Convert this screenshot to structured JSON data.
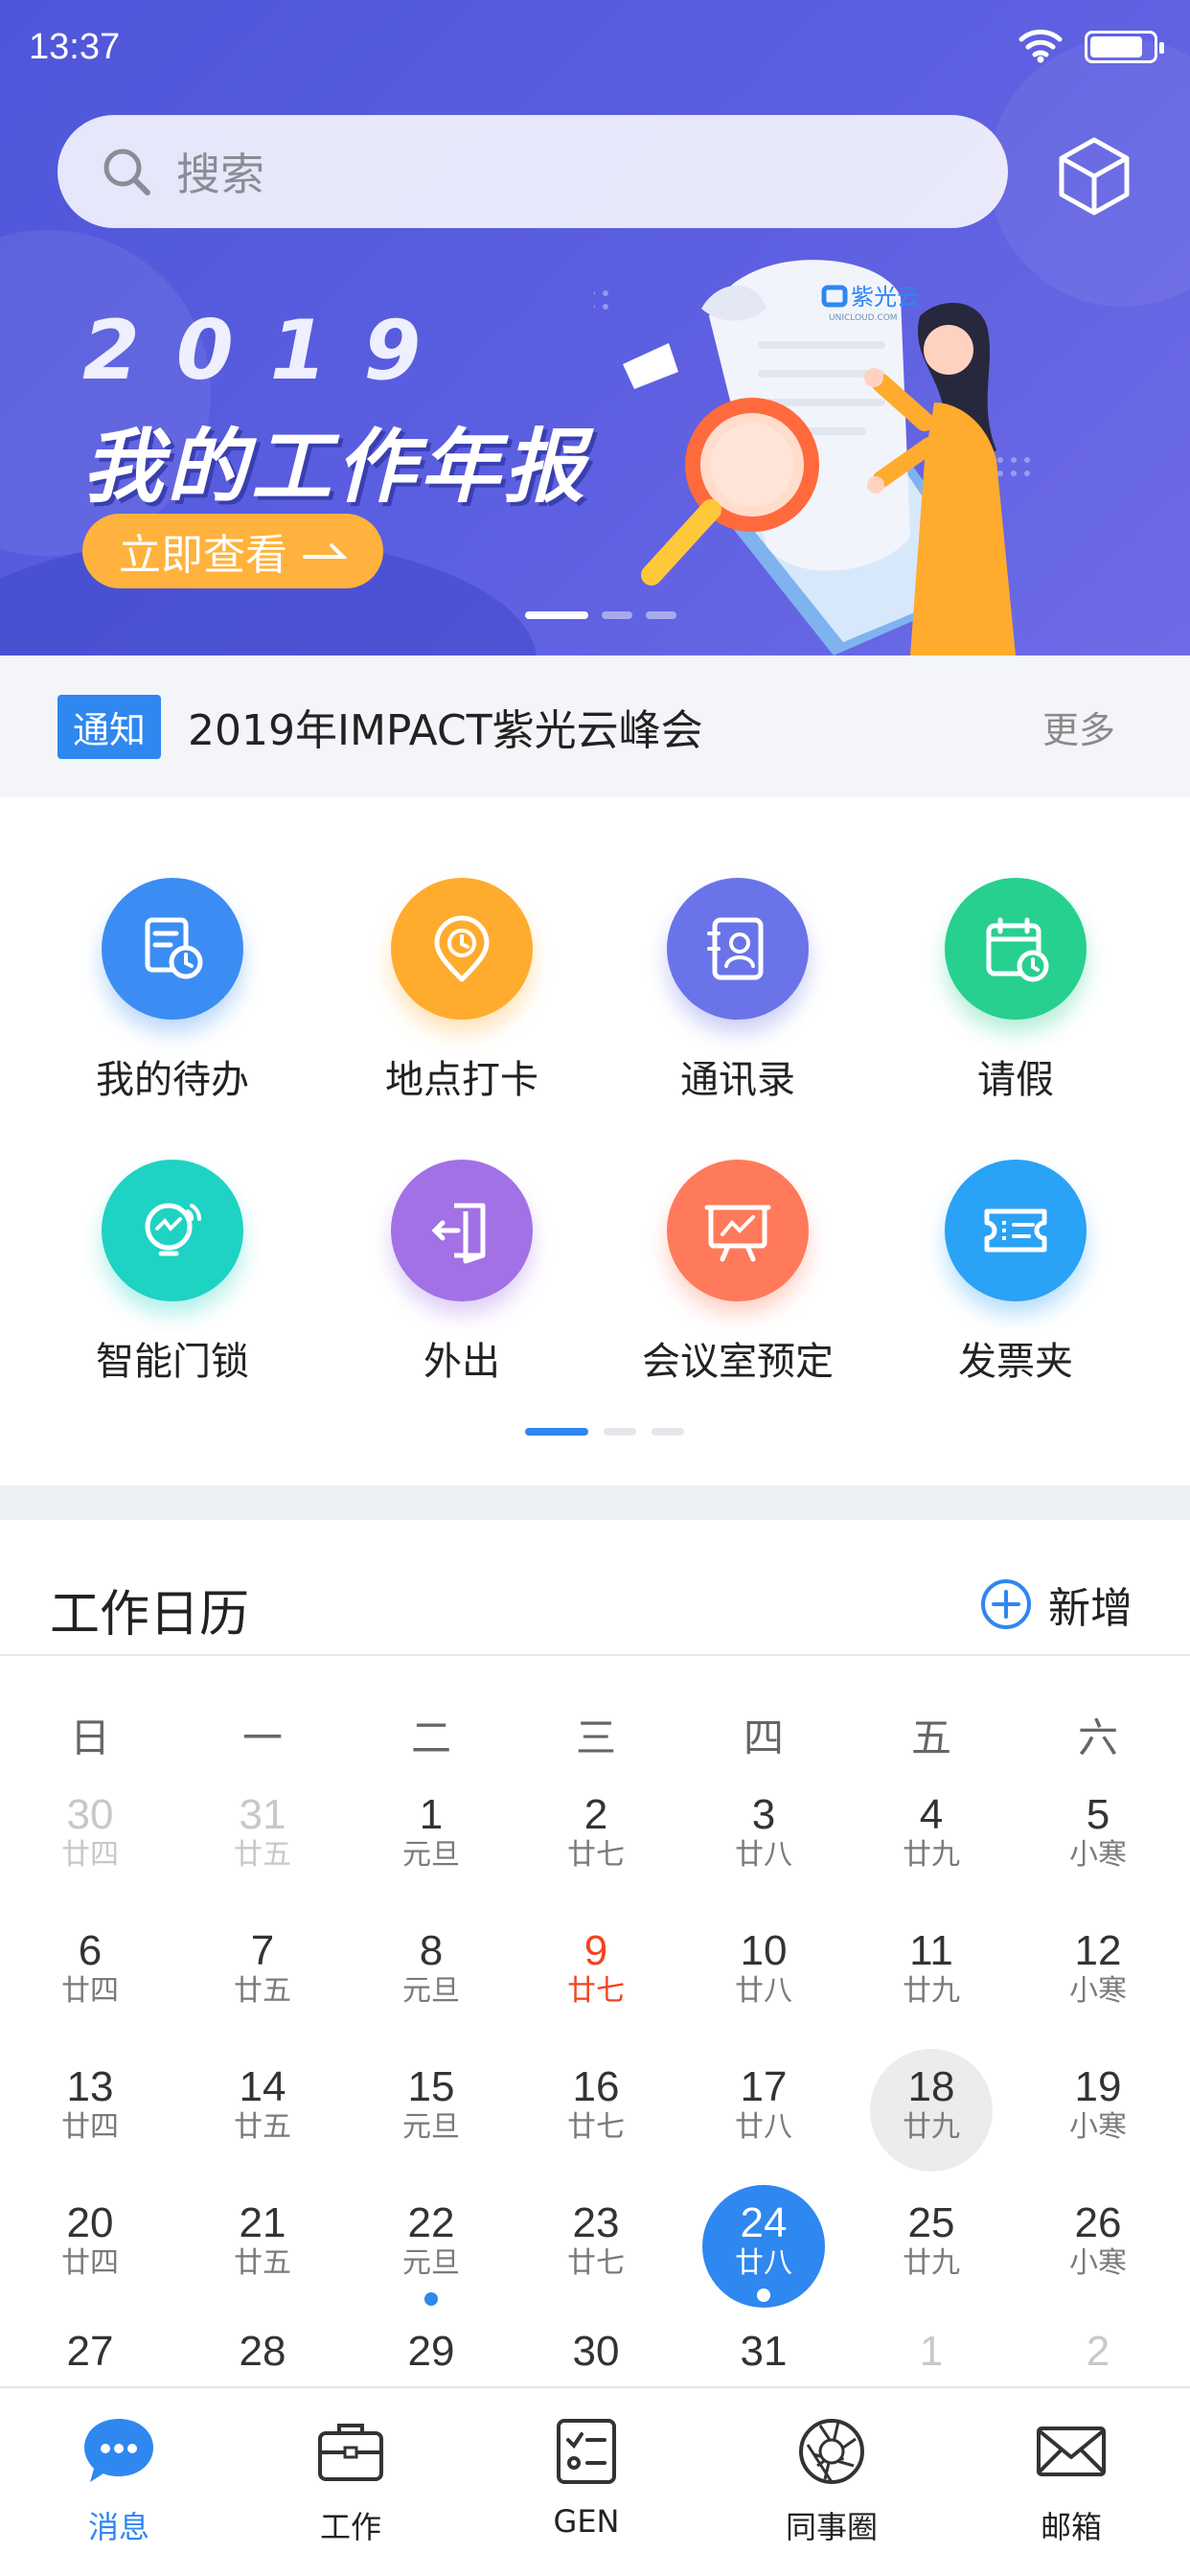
{
  "status_bar": {
    "time": "13:37",
    "battery_level": 0.85
  },
  "search": {
    "placeholder": "搜索"
  },
  "banner": {
    "year": "2019",
    "title": "我的工作年报",
    "cta": "立即查看",
    "brand": "紫光云",
    "brand_sub": "UNICLOUD.COM",
    "slide_count": 3,
    "active_slide": 0
  },
  "notice": {
    "tag": "通知",
    "text": "2019年IMPACT紫光云峰会",
    "more": "更多"
  },
  "apps": [
    {
      "label": "我的待办",
      "icon": "todo-icon",
      "color": "#3c8df3"
    },
    {
      "label": "地点打卡",
      "icon": "location-clock-icon",
      "color": "#ffab2e"
    },
    {
      "label": "通讯录",
      "icon": "contacts-icon",
      "color": "#6a74e8"
    },
    {
      "label": "请假",
      "icon": "calendar-leave-icon",
      "color": "#27d08f"
    },
    {
      "label": "智能门锁",
      "icon": "smart-lock-icon",
      "color": "#1ed3c3"
    },
    {
      "label": "外出",
      "icon": "go-out-icon",
      "color": "#a271e6"
    },
    {
      "label": "会议室预定",
      "icon": "meeting-room-icon",
      "color": "#ff7a5a"
    },
    {
      "label": "发票夹",
      "icon": "invoice-icon",
      "color": "#2aa2f6"
    }
  ],
  "apps_pager": {
    "pages": 3,
    "active": 0
  },
  "calendar": {
    "title": "工作日历",
    "add_label": "新增",
    "weekdays": [
      "日",
      "一",
      "二",
      "三",
      "四",
      "五",
      "六"
    ],
    "weeks": [
      [
        {
          "d": "30",
          "l": "廿四",
          "s": "dim"
        },
        {
          "d": "31",
          "l": "廿五",
          "s": "dim"
        },
        {
          "d": "1",
          "l": "元旦"
        },
        {
          "d": "2",
          "l": "廿七"
        },
        {
          "d": "3",
          "l": "廿八"
        },
        {
          "d": "4",
          "l": "廿九"
        },
        {
          "d": "5",
          "l": "小寒"
        }
      ],
      [
        {
          "d": "6",
          "l": "廿四"
        },
        {
          "d": "7",
          "l": "廿五"
        },
        {
          "d": "8",
          "l": "元旦"
        },
        {
          "d": "9",
          "l": "廿七",
          "s": "red"
        },
        {
          "d": "10",
          "l": "廿八"
        },
        {
          "d": "11",
          "l": "廿九"
        },
        {
          "d": "12",
          "l": "小寒"
        }
      ],
      [
        {
          "d": "13",
          "l": "廿四"
        },
        {
          "d": "14",
          "l": "廿五"
        },
        {
          "d": "15",
          "l": "元旦"
        },
        {
          "d": "16",
          "l": "廿七"
        },
        {
          "d": "17",
          "l": "廿八"
        },
        {
          "d": "18",
          "l": "廿九",
          "s": "gray"
        },
        {
          "d": "19",
          "l": "小寒"
        }
      ],
      [
        {
          "d": "20",
          "l": "廿四"
        },
        {
          "d": "21",
          "l": "廿五"
        },
        {
          "d": "22",
          "l": "元旦",
          "dot": true
        },
        {
          "d": "23",
          "l": "廿七"
        },
        {
          "d": "24",
          "l": "廿八",
          "s": "sel",
          "dot": true
        },
        {
          "d": "25",
          "l": "廿九"
        },
        {
          "d": "26",
          "l": "小寒"
        }
      ],
      [
        {
          "d": "27",
          "l": ""
        },
        {
          "d": "28",
          "l": ""
        },
        {
          "d": "29",
          "l": ""
        },
        {
          "d": "30",
          "l": ""
        },
        {
          "d": "31",
          "l": ""
        },
        {
          "d": "1",
          "l": "",
          "s": "dim"
        },
        {
          "d": "2",
          "l": "",
          "s": "dim"
        }
      ]
    ]
  },
  "tabs": [
    {
      "label": "消息",
      "icon": "message-icon",
      "active": true
    },
    {
      "label": "工作",
      "icon": "briefcase-icon"
    },
    {
      "label": "GEN",
      "icon": "checklist-icon"
    },
    {
      "label": "同事圈",
      "icon": "aperture-icon"
    },
    {
      "label": "邮箱",
      "icon": "mail-icon"
    }
  ],
  "colors": {
    "accent": "#2f87f0",
    "hero": "#5b5ee0",
    "cta": "#ffb23d",
    "holiday_red": "#f2441d"
  }
}
